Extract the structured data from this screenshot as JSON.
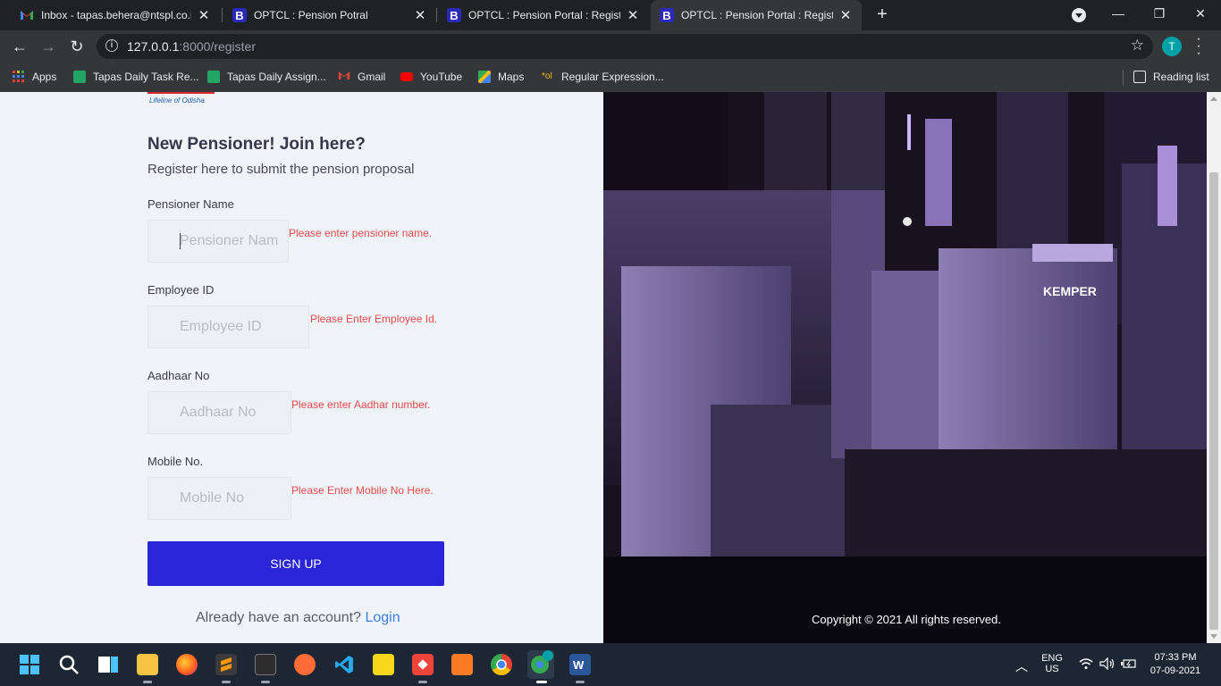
{
  "tabs": [
    {
      "title": "Inbox - tapas.behera@ntspl.co.in",
      "icon": "gmail-icon",
      "active": false
    },
    {
      "title": "OPTCL : Pension Potral",
      "icon": "bootstrap-icon",
      "active": false
    },
    {
      "title": "OPTCL : Pension Portal : Registart",
      "icon": "bootstrap-icon",
      "active": false
    },
    {
      "title": "OPTCL : Pension Portal : Registart",
      "icon": "bootstrap-icon",
      "active": true
    }
  ],
  "address": {
    "host": "127.0.0.1",
    "path": ":8000/register"
  },
  "profile_initial": "T",
  "bookmarks": [
    {
      "label": "Apps",
      "icon": "apps-grid-icon"
    },
    {
      "label": "Tapas Daily Task Re...",
      "icon": "sheets-icon"
    },
    {
      "label": "Tapas Daily Assign...",
      "icon": "sheets-icon"
    },
    {
      "label": "Gmail",
      "icon": "gmail-icon"
    },
    {
      "label": "YouTube",
      "icon": "youtube-icon"
    },
    {
      "label": "Maps",
      "icon": "maps-icon"
    },
    {
      "label": "Regular Expression...",
      "icon": "regex-icon"
    }
  ],
  "reading_list": "Reading list",
  "brand": {
    "tagline": "Lifeline of Odisha"
  },
  "form": {
    "heading": "New Pensioner! Join here?",
    "subheading": "Register here to submit the pension proposal",
    "fields": [
      {
        "label": "Pensioner Name",
        "placeholder": "Pensioner Nam",
        "error": "Please enter pensioner name."
      },
      {
        "label": "Employee ID",
        "placeholder": "Employee ID",
        "error": "Please Enter Employee Id."
      },
      {
        "label": "Aadhaar No",
        "placeholder": "Aadhaar No",
        "error": "Please enter Aadhar number."
      },
      {
        "label": "Mobile No.",
        "placeholder": "Mobile No",
        "error": "Please Enter Mobile No Here."
      }
    ],
    "submit": "SIGN UP",
    "already_text": "Already have an account?",
    "login_link": "Login"
  },
  "hero": {
    "sign_text": "KEMPER"
  },
  "copyright": "Copyright © 2021 All rights reserved.",
  "taskbar": {
    "lang": "ENG",
    "region": "US",
    "time": "07:33 PM",
    "date": "07-09-2021",
    "apps": [
      "windows-start-icon",
      "search-icon",
      "task-view-icon",
      "file-explorer-icon",
      "firefox-icon",
      "sublime-text-icon",
      "terminal-icon",
      "postman-icon",
      "vscode-icon",
      "sticky-notes-icon",
      "anydesk-icon",
      "xampp-icon",
      "chrome-icon",
      "chrome-profile-icon",
      "word-icon"
    ]
  },
  "colors": {
    "accent": "#2926d9",
    "error": "#e44d4d",
    "link": "#3b7de0"
  }
}
